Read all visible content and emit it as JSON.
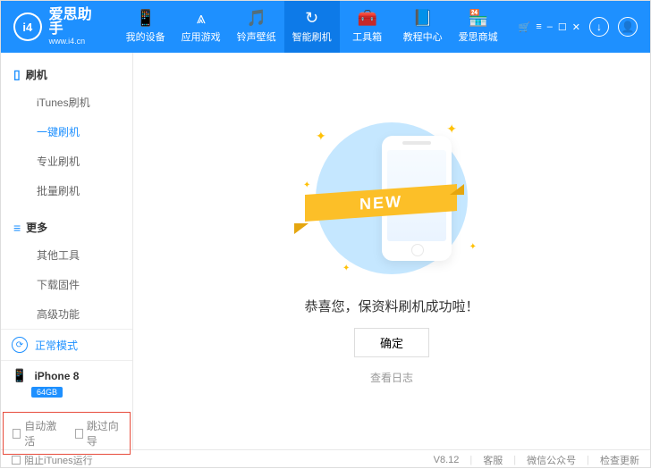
{
  "brand": {
    "name": "爱思助手",
    "url": "www.i4.cn",
    "logo_text": "i4"
  },
  "nav": [
    {
      "label": "我的设备",
      "icon": "📱"
    },
    {
      "label": "应用游戏",
      "icon": "⩓"
    },
    {
      "label": "铃声壁纸",
      "icon": "🎵"
    },
    {
      "label": "智能刷机",
      "icon": "↻",
      "active": true
    },
    {
      "label": "工具箱",
      "icon": "🧰"
    },
    {
      "label": "教程中心",
      "icon": "📘"
    },
    {
      "label": "爱思商城",
      "icon": "🏪"
    }
  ],
  "sidebar": {
    "section1": {
      "title": "刷机",
      "items": [
        "iTunes刷机",
        "一键刷机",
        "专业刷机",
        "批量刷机"
      ],
      "active_index": 1
    },
    "section2": {
      "title": "更多",
      "items": [
        "其他工具",
        "下载固件",
        "高级功能"
      ]
    }
  },
  "mode": {
    "label": "正常模式"
  },
  "device": {
    "name": "iPhone 8",
    "capacity": "64GB"
  },
  "options": {
    "auto_activate": "自动激活",
    "skip_guide": "跳过向导"
  },
  "content": {
    "ribbon": "NEW",
    "message": "恭喜您，保资料刷机成功啦！",
    "ok": "确定",
    "view_log": "查看日志"
  },
  "footer": {
    "block_itunes": "阻止iTunes运行",
    "version": "V8.12",
    "support": "客服",
    "wechat": "微信公众号",
    "update": "检查更新"
  }
}
